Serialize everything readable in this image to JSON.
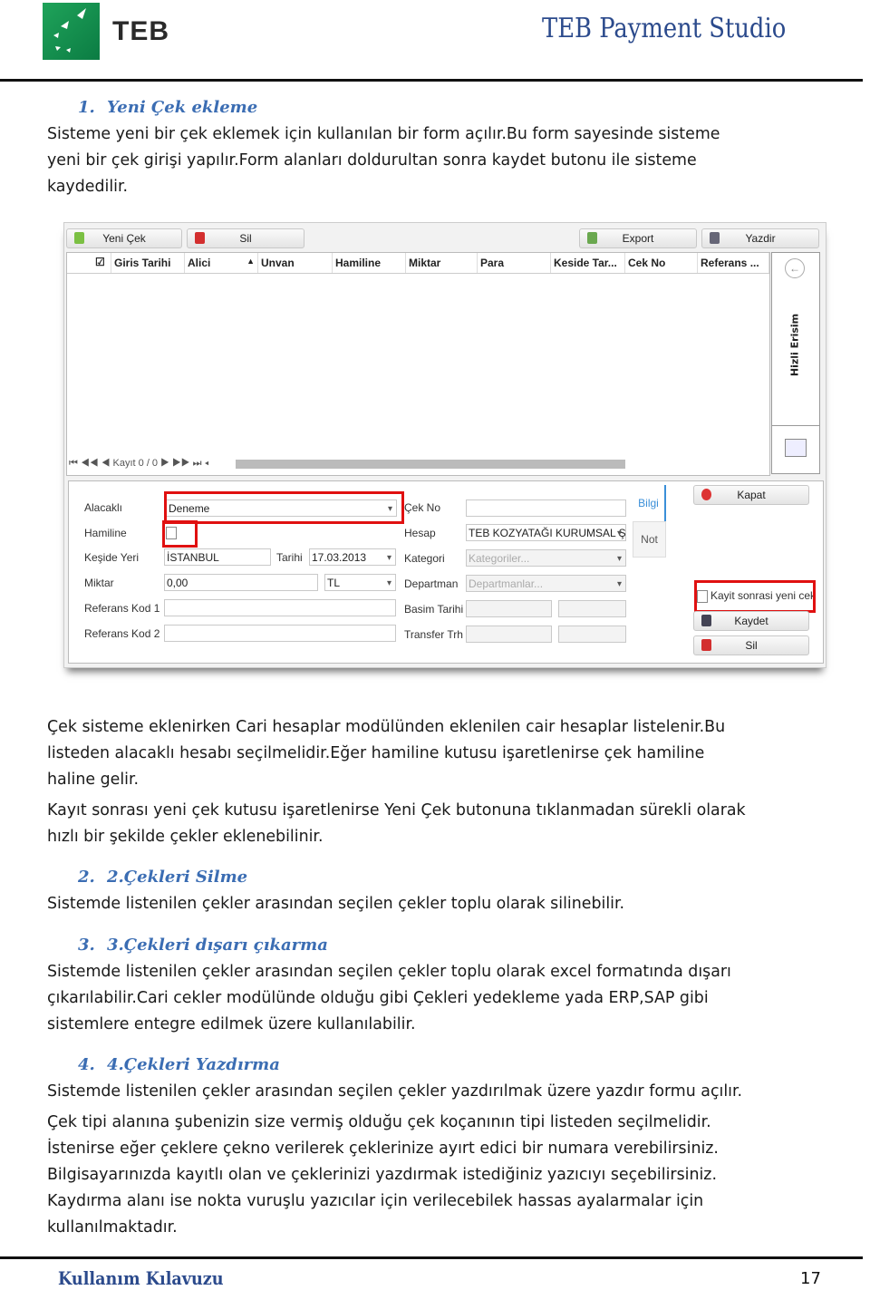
{
  "header": {
    "logo_text": "TEB",
    "doc_title": "TEB Payment Studio"
  },
  "sections": [
    {
      "num": "1.",
      "title": "Yeni Çek ekleme",
      "lines": [
        "Sisteme yeni bir çek eklemek için kullanılan bir form açılır.Bu form sayesinde sisteme",
        "yeni bir çek girişi yapılır.Form alanları doldurultan sonra kaydet butonu ile sisteme",
        "kaydedilir."
      ]
    },
    {
      "num": "2.",
      "title": "2.Çekleri Silme",
      "lines": [
        "Sistemde listenilen çekler arasından seçilen çekler toplu olarak silinebilir."
      ]
    },
    {
      "num": "3.",
      "title": "3.Çekleri dışarı çıkarma",
      "lines": [
        "Sistemde listenilen çekler arasından seçilen çekler toplu olarak excel formatında dışarı",
        "çıkarılabilir.Cari cekler modülünde olduğu gibi Çekleri yedekleme yada ERP,SAP gibi",
        "sistemlere entegre edilmek üzere kullanılabilir."
      ]
    },
    {
      "num": "4.",
      "title": "4.Çekleri Yazdırma",
      "lines": [
        "Sistemde listenilen çekler arasından seçilen çekler yazdırılmak üzere yazdır formu açılır."
      ]
    }
  ],
  "after_screenshot": {
    "p1": [
      "Çek sisteme eklenirken Cari hesaplar modülünden eklenilen cair hesaplar listelenir.Bu",
      "listeden alacaklı hesabı seçilmelidir.Eğer hamiline kutusu işaretlenirse çek hamiline",
      "haline gelir."
    ],
    "p2": [
      "Kayıt sonrası yeni çek kutusu işaretlenirse Yeni Çek butonuna tıklanmadan sürekli olarak",
      "hızlı bir şekilde çekler eklenebilinir."
    ]
  },
  "final_paragraph": [
    "Çek tipi alanına şubenizin size vermiş olduğu çek koçanının tipi listeden seçilmelidir.",
    "İstenirse eğer çeklere çekno verilerek çeklerinize ayırt edici bir numara verebilirsiniz.",
    "Bilgisayarınızda kayıtlı olan ve çeklerinizi yazdırmak istediğiniz yazıcıyı seçebilirsiniz.",
    "Kaydırma alanı ise nokta vuruşlu yazıcılar için verilecebilek hassas ayalarmalar için",
    "kullanılmaktadır."
  ],
  "app": {
    "toolbar": {
      "new": "Yeni Çek",
      "delete": "Sil",
      "export": "Export",
      "print": "Yazdir"
    },
    "columns": [
      "Giris Tarihi",
      "Alici",
      "Unvan",
      "Hamiline",
      "Miktar",
      "Para",
      "Keside Tar...",
      "Cek No",
      "Referans ..."
    ],
    "side_panel": "Hizli Erisim",
    "pager": "Kayıt 0 / 0",
    "form": {
      "alacakli_label": "Alacaklı",
      "alacakli_value": "Deneme",
      "hamiline_label": "Hamiline",
      "keside_yeri_label": "Keşide Yeri",
      "keside_yeri_value": "İSTANBUL",
      "tarihi_label": "Tarihi",
      "tarihi_value": "17.03.2013",
      "miktar_label": "Miktar",
      "miktar_value": "0,00",
      "para_value": "TL",
      "ref1_label": "Referans Kod 1",
      "ref2_label": "Referans Kod 2",
      "cekno_label": "Çek No",
      "hesap_label": "Hesap",
      "hesap_value": "TEB KOZYATAĞI KURUMSAL ŞL",
      "kategori_label": "Kategori",
      "kategori_placeholder": "Kategoriler...",
      "departman_label": "Departman",
      "departman_placeholder": "Departmanlar...",
      "basim_label": "Basim Tarihi",
      "transfer_label": "Transfer Trh",
      "tab_bilgi": "Bilgi",
      "tab_not": "Not",
      "kapat": "Kapat",
      "kayit_sonrasi": "Kayit sonrasi yeni cek",
      "kaydet": "Kaydet",
      "sil": "Sil"
    }
  },
  "footer": {
    "title": "Kullanım Kılavuzu",
    "page": "17"
  }
}
